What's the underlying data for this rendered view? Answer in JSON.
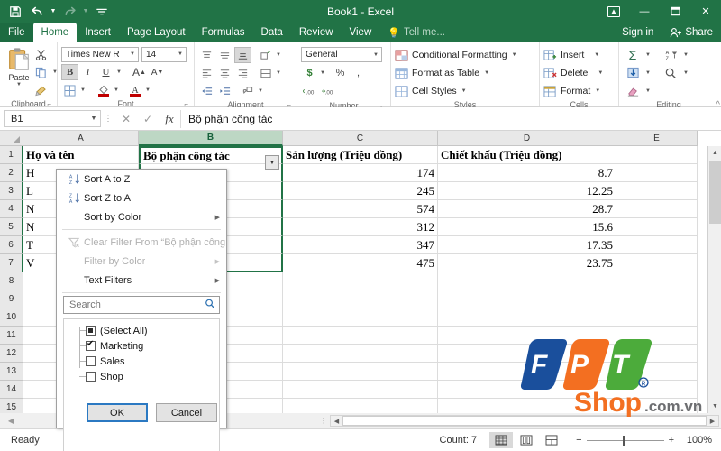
{
  "titlebar": {
    "title": "Book1 - Excel",
    "qat": [
      {
        "name": "save-icon",
        "glyph": "💾"
      },
      {
        "name": "undo-icon",
        "glyph": "↶"
      },
      {
        "name": "redo-icon",
        "glyph": "↷"
      },
      {
        "name": "customize-qat-icon",
        "glyph": "≡"
      }
    ],
    "ribbon_display_label": "↑",
    "minimize_label": "—",
    "restore_label": "❐",
    "close_label": "✕"
  },
  "tabs": [
    {
      "label": "File",
      "active": false,
      "file": true
    },
    {
      "label": "Home",
      "active": true,
      "file": false
    },
    {
      "label": "Insert",
      "active": false,
      "file": false
    },
    {
      "label": "Page Layout",
      "active": false,
      "file": false
    },
    {
      "label": "Formulas",
      "active": false,
      "file": false
    },
    {
      "label": "Data",
      "active": false,
      "file": false
    },
    {
      "label": "Review",
      "active": false,
      "file": false
    },
    {
      "label": "View",
      "active": false,
      "file": false
    }
  ],
  "tellme": "Tell me...",
  "signin": "Sign in",
  "share": "Share",
  "ribbon": {
    "clipboard": {
      "label": "Clipboard",
      "paste": "Paste",
      "cut": "✂",
      "copy": "⧉",
      "format_painter": "🖌"
    },
    "font": {
      "label": "Font",
      "font_name": "Times New R",
      "font_size": "14",
      "bold": "B",
      "italic": "I",
      "underline": "U",
      "grow_font": "A",
      "shrink_font": "A",
      "borders": "▦",
      "fill_color": "A",
      "font_color": "A"
    },
    "alignment": {
      "label": "Alignment",
      "align_top": "≡",
      "align_middle": "≡",
      "align_bottom": "≡",
      "orientation": "➶",
      "align_left": "≡",
      "align_center": "≡",
      "align_right": "≡",
      "wrap_text": "⬚",
      "decrease_indent": "⇤",
      "increase_indent": "⇥",
      "merge_center": "⬚"
    },
    "number": {
      "label": "Number",
      "format": "General",
      "currency": "$",
      "percent": "%",
      "comma": ",",
      "increase_decimal": ".00",
      "decrease_decimal": ".0"
    },
    "styles": {
      "label": "Styles",
      "conditional_formatting": "Conditional Formatting",
      "format_as_table": "Format as Table",
      "cell_styles": "Cell Styles"
    },
    "cells": {
      "label": "Cells",
      "insert": "Insert",
      "delete": "Delete",
      "format": "Format"
    },
    "editing": {
      "label": "Editing",
      "autosum": "Σ",
      "fill": "⬇",
      "clear": "◢",
      "sort_filter": "A\nZ",
      "find_select": "🔍",
      "collapse": "∧"
    }
  },
  "formulabar": {
    "namebox": "B1",
    "cancel": "✕",
    "enter": "✓",
    "insert_function": "fx",
    "value": "Bộ phận công tác"
  },
  "grid": {
    "columns": [
      {
        "letter": "A",
        "width": 128,
        "selected": false
      },
      {
        "letter": "B",
        "width": 160,
        "selected": true
      },
      {
        "letter": "C",
        "width": 172,
        "selected": false
      },
      {
        "letter": "D",
        "width": 198,
        "selected": false
      },
      {
        "letter": "E",
        "width": 90,
        "selected": false
      }
    ],
    "row_numbers": [
      "1",
      "2",
      "3",
      "4",
      "5",
      "6",
      "7",
      "8",
      "9",
      "10",
      "11",
      "12",
      "13",
      "14",
      "15"
    ],
    "rows": [
      {
        "A": "Họ và tên",
        "B": "Bộ phận công tác",
        "C": "Sản lượng (Triệu đồng)",
        "D": "Chiết khấu (Triệu đồng)",
        "E": "",
        "header": true
      },
      {
        "A": "H",
        "B": "",
        "C": "174",
        "D": "8.7",
        "E": "",
        "header": false
      },
      {
        "A": "L",
        "B": "",
        "C": "245",
        "D": "12.25",
        "E": "",
        "header": false
      },
      {
        "A": "N",
        "B": "",
        "C": "574",
        "D": "28.7",
        "E": "",
        "header": false
      },
      {
        "A": "N",
        "B": "",
        "C": "312",
        "D": "15.6",
        "E": "",
        "header": false
      },
      {
        "A": "T",
        "B": "",
        "C": "347",
        "D": "17.35",
        "E": "",
        "header": false
      },
      {
        "A": "V",
        "B": "",
        "C": "475",
        "D": "23.75",
        "E": "",
        "header": false
      },
      {
        "A": "",
        "B": "",
        "C": "",
        "D": "",
        "E": "",
        "header": false
      },
      {
        "A": "",
        "B": "",
        "C": "",
        "D": "",
        "E": "",
        "header": false
      },
      {
        "A": "",
        "B": "",
        "C": "",
        "D": "",
        "E": "",
        "header": false
      },
      {
        "A": "",
        "B": "",
        "C": "",
        "D": "",
        "E": "",
        "header": false
      },
      {
        "A": "",
        "B": "",
        "C": "",
        "D": "",
        "E": "",
        "header": false
      },
      {
        "A": "",
        "B": "",
        "C": "",
        "D": "",
        "E": "",
        "header": false
      },
      {
        "A": "",
        "B": "",
        "C": "",
        "D": "",
        "E": "",
        "header": false
      },
      {
        "A": "",
        "B": "",
        "C": "",
        "D": "",
        "E": "",
        "header": false
      }
    ]
  },
  "filter_menu": {
    "items": [
      {
        "label": "Sort A to Z",
        "icon": "sort-ascending-icon",
        "glyph": "↓",
        "disabled": false,
        "submenu": false
      },
      {
        "label": "Sort Z to A",
        "icon": "sort-descending-icon",
        "glyph": "↓",
        "disabled": false,
        "submenu": false
      },
      {
        "label": "Sort by Color",
        "icon": "none",
        "glyph": "",
        "disabled": false,
        "submenu": true
      },
      {
        "label": "Clear Filter From “Bộ phận công tác”",
        "icon": "clear-filter-icon",
        "glyph": "✗",
        "disabled": true,
        "submenu": false
      },
      {
        "label": "Filter by Color",
        "icon": "none",
        "glyph": "",
        "disabled": true,
        "submenu": true
      },
      {
        "label": "Text Filters",
        "icon": "none",
        "glyph": "",
        "disabled": false,
        "submenu": true
      }
    ],
    "search_placeholder": "Search",
    "search_icon": "search-icon",
    "checklist": [
      {
        "label": "(Select All)",
        "state": "partial"
      },
      {
        "label": "Marketing",
        "state": "checked"
      },
      {
        "label": "Sales",
        "state": "unchecked"
      },
      {
        "label": "Shop",
        "state": "unchecked"
      }
    ],
    "ok": "OK",
    "cancel": "Cancel"
  },
  "logo": {
    "f": "F",
    "p": "P",
    "t": "T",
    "reg": "®",
    "shop": "Shop",
    "domain": ".com.vn",
    "colors": {
      "f": "#1a4f9c",
      "p": "#f36f21",
      "t": "#4cab3b",
      "shop": "#f36f21",
      "domain": "#6d6e71"
    }
  },
  "statusbar": {
    "ready": "Ready",
    "count": "Count: 7",
    "views": [
      {
        "name": "normal-view-button",
        "glyph": "▦",
        "active": true
      },
      {
        "name": "page-layout-view-button",
        "glyph": "▥",
        "active": false
      },
      {
        "name": "page-break-view-button",
        "glyph": "▤",
        "active": false
      }
    ],
    "zoom_out": "−",
    "zoom_in": "+",
    "zoom_level": "100%"
  },
  "colors": {
    "excel_green": "#217346",
    "accent_blue": "#2b79c2"
  }
}
